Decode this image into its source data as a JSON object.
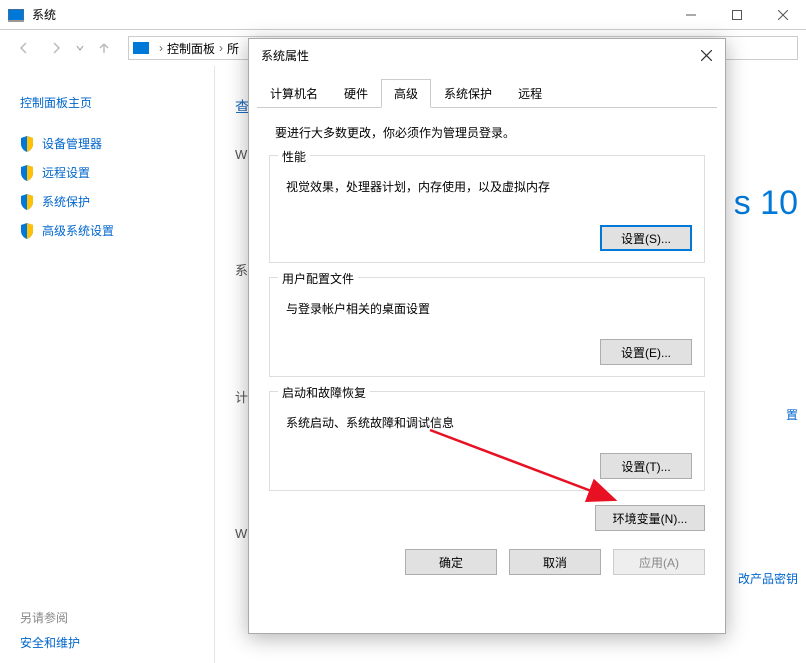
{
  "titlebar": {
    "title": "系统"
  },
  "breadcrumb": {
    "root": "控制面板",
    "sub": "所"
  },
  "sidebar": {
    "title": "控制面板主页",
    "items": [
      {
        "label": "设备管理器"
      },
      {
        "label": "远程设置"
      },
      {
        "label": "系统保护"
      },
      {
        "label": "高级系统设置"
      }
    ],
    "see_also_title": "另请参阅",
    "see_also_link": "安全和维护"
  },
  "main": {
    "hint": "查",
    "w1": "W",
    "sys_label": "系",
    "calc_label": "计",
    "w2": "W",
    "win10": "s 10",
    "link1": "置",
    "link2": "改产品密钥"
  },
  "dialog": {
    "title": "系统属性",
    "tabs": [
      "计算机名",
      "硬件",
      "高级",
      "系统保护",
      "远程"
    ],
    "active_tab": 2,
    "lead": "要进行大多数更改，你必须作为管理员登录。",
    "groups": [
      {
        "title": "性能",
        "desc": "视觉效果，处理器计划，内存使用，以及虚拟内存",
        "button": "设置(S)..."
      },
      {
        "title": "用户配置文件",
        "desc": "与登录帐户相关的桌面设置",
        "button": "设置(E)..."
      },
      {
        "title": "启动和故障恢复",
        "desc": "系统启动、系统故障和调试信息",
        "button": "设置(T)..."
      }
    ],
    "env_button": "环境变量(N)...",
    "footer": {
      "ok": "确定",
      "cancel": "取消",
      "apply": "应用(A)"
    }
  }
}
